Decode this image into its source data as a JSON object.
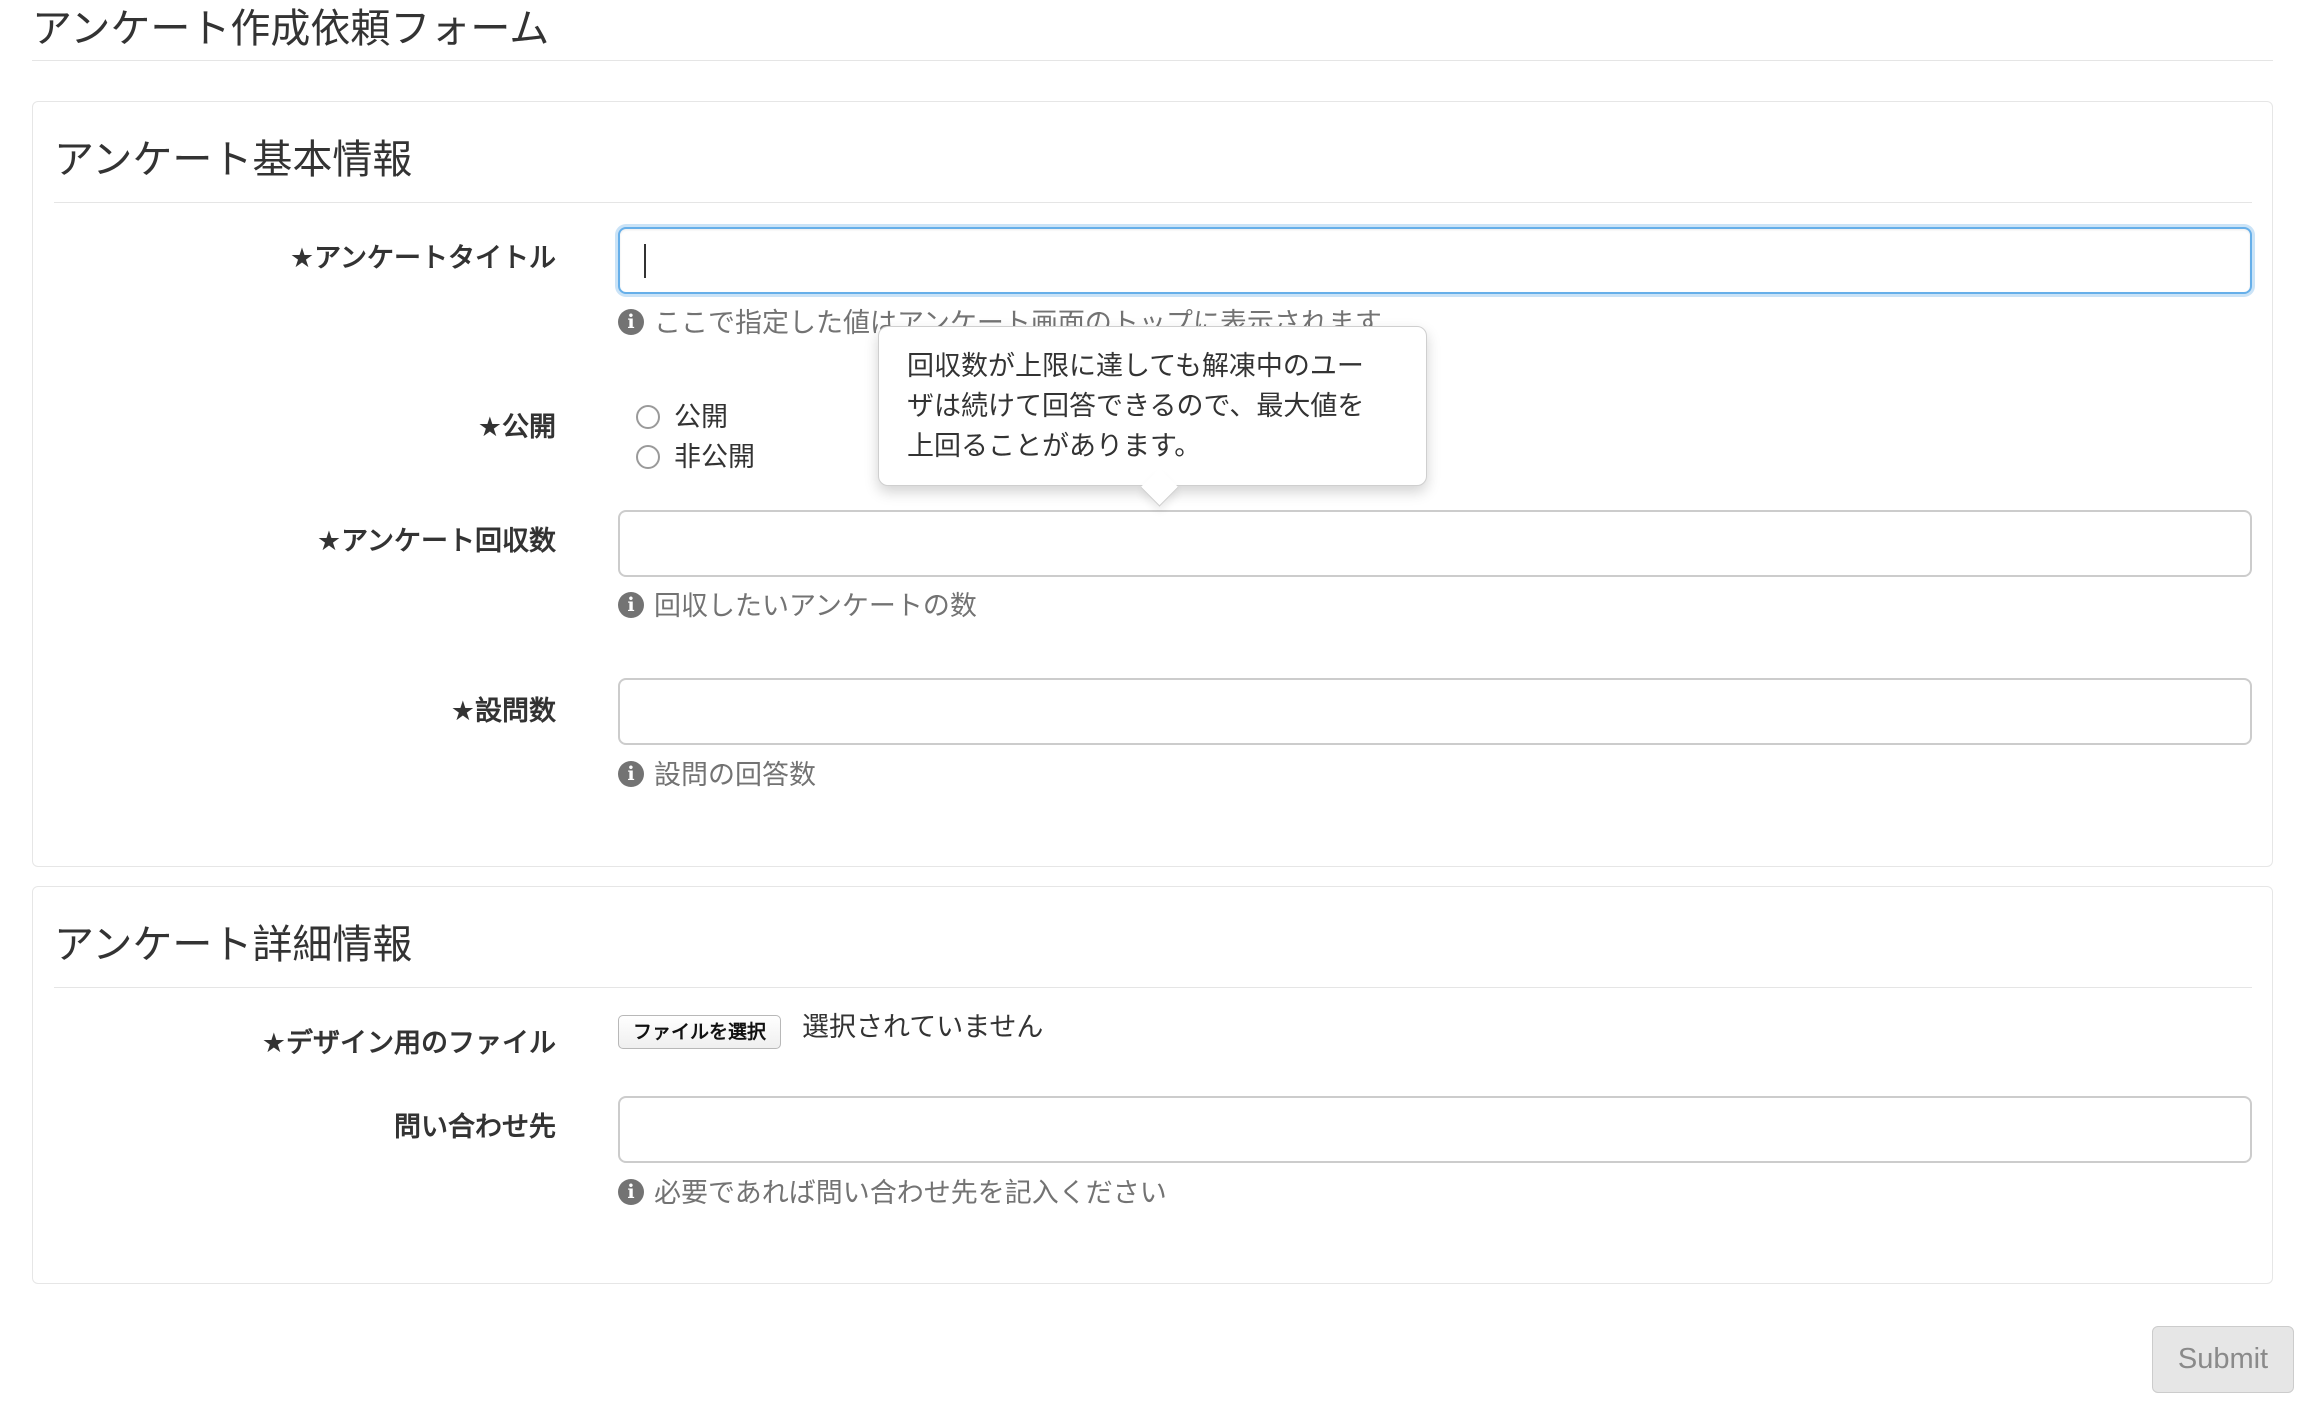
{
  "page_title": "アンケート作成依頼フォーム",
  "basic_section": {
    "legend": "アンケート基本情報",
    "title_field": {
      "label": "★アンケートタイトル",
      "value": "",
      "help": "ここで指定した値はアンケート画面のトップに表示されます"
    },
    "publish_field": {
      "label": "★公開",
      "options": [
        "公開",
        "非公開"
      ]
    },
    "count_field": {
      "label": "★アンケート回収数",
      "value": "",
      "help": "回収したいアンケートの数"
    },
    "questions_field": {
      "label": "★設問数",
      "value": "",
      "help": "設問の回答数"
    }
  },
  "tooltip": {
    "lines": [
      "回収数が上限に達しても解凍中のユー",
      "ザは続けて回答できるので、最大値を",
      "上回ることがあります。"
    ]
  },
  "detail_section": {
    "legend": "アンケート詳細情報",
    "design_file": {
      "label": "★デザイン用のファイル",
      "button": "ファイルを選択",
      "status": "選択されていません"
    },
    "contact_field": {
      "label": "問い合わせ先",
      "value": "",
      "help": "必要であれば問い合わせ先を記入ください"
    }
  },
  "submit_label": "Submit",
  "icons": {
    "info": "info-circle-icon"
  },
  "colors": {
    "focus_border": "#66afe9",
    "help_text": "#737373"
  }
}
